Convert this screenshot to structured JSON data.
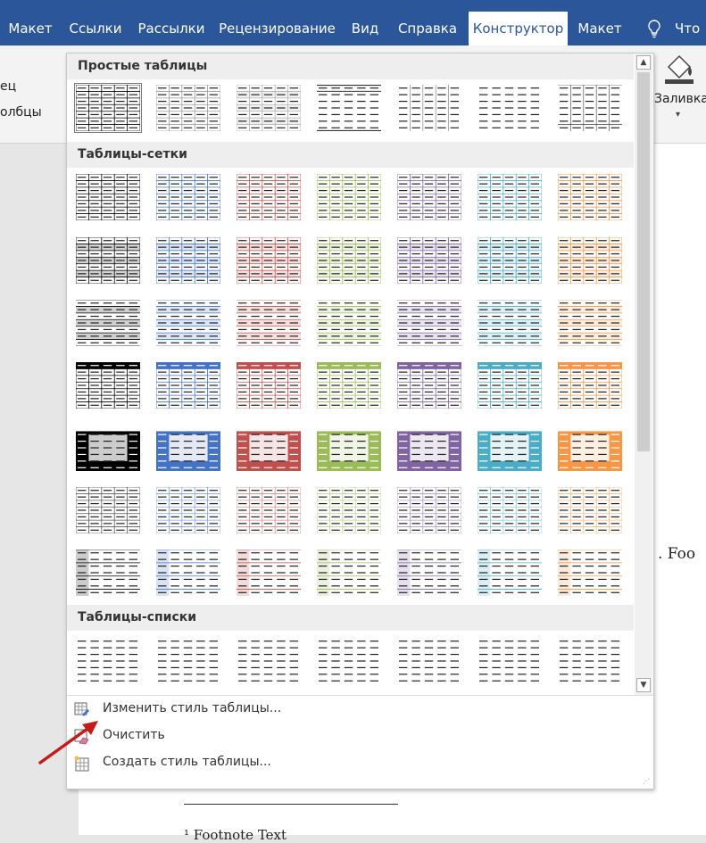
{
  "tabs": [
    "Макет",
    "Ссылки",
    "Рассылки",
    "Рецензирование",
    "Вид",
    "Справка",
    "Конструктор",
    "Макет"
  ],
  "tell_me": "Что в",
  "ribbon": {
    "left_line1": "ец",
    "left_line2": "олбцы",
    "shading_label": "Заливка",
    "shading_arrow": "▾"
  },
  "doc": {
    "right_text": ".   Foo",
    "footnote": "¹ Footnote Text"
  },
  "sections": {
    "plain": "Простые таблицы",
    "grid": "Таблицы-сетки",
    "list": "Таблицы-списки"
  },
  "menu": {
    "modify": "Изменить стиль таблицы...",
    "clear": "Очистить",
    "new": "Создать стиль таблицы..."
  },
  "colors": {
    "ribbon": "#2b579a",
    "palette": [
      "#000000",
      "#4472c4",
      "#c0504d",
      "#9bbb59",
      "#8064a2",
      "#4bacc6",
      "#f79646"
    ]
  },
  "scroll": {
    "up": "▲",
    "down": "▼"
  }
}
